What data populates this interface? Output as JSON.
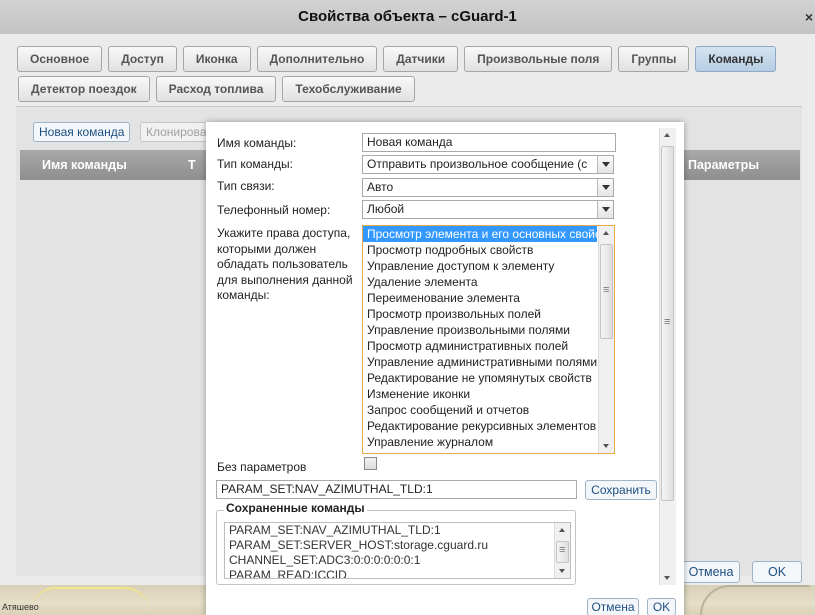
{
  "window": {
    "title": "Свойства объекта – cGuard-1",
    "close": "×"
  },
  "tabs_row1": [
    {
      "label": "Основное",
      "active": false
    },
    {
      "label": "Доступ",
      "active": false
    },
    {
      "label": "Иконка",
      "active": false
    },
    {
      "label": "Дополнительно",
      "active": false
    },
    {
      "label": "Датчики",
      "active": false
    },
    {
      "label": "Произвольные поля",
      "active": false
    },
    {
      "label": "Группы",
      "active": false
    },
    {
      "label": "Команды",
      "active": true
    }
  ],
  "tabs_row2": [
    {
      "label": "Детектор поездок"
    },
    {
      "label": "Расход топлива"
    },
    {
      "label": "Техобслуживание"
    }
  ],
  "commands_panel": {
    "new_command": "Новая команда",
    "clone": "Клонирова",
    "col_name": "Имя команды",
    "col_type": "Т",
    "col_params": "Параметры",
    "cancel": "Отмена",
    "ok": "OK"
  },
  "dialog": {
    "name_label": "Имя команды:",
    "name_value": "Новая команда",
    "type_label": "Тип команды:",
    "type_value": "Отправить произвольное сообщение (с",
    "link_label": "Тип связи:",
    "link_value": "Авто",
    "phone_label": "Телефонный номер:",
    "phone_value": "Любой",
    "rights_label_lines": [
      "Укажите права доступа,",
      "которыми должен",
      "обладать пользователь",
      "для выполнения данной",
      "команды:"
    ],
    "rights_options": [
      "Просмотр элемента и его основных свойств",
      "Просмотр подробных свойств",
      "Управление доступом к элементу",
      "Удаление элемента",
      "Переименование элемента",
      "Просмотр произвольных полей",
      "Управление произвольными полями",
      "Просмотр административных полей",
      "Управление административными полями",
      "Редактирование не упомянутых свойств",
      "Изменение иконки",
      "Запрос сообщений и отчетов",
      "Редактирование рекурсивных элементов",
      "Управление журналом"
    ],
    "rights_selected_index": 0,
    "no_params_label": "Без параметров",
    "no_params_checked": false,
    "param_value": "PARAM_SET:NAV_AZIMUTHAL_TLD:1",
    "save": "Сохранить",
    "saved_legend": "Сохраненные команды",
    "saved_commands": [
      "PARAM_SET:NAV_AZIMUTHAL_TLD:1",
      "PARAM_SET:SERVER_HOST:storage.cguard.ru",
      "CHANNEL_SET:ADC3:0:0:0:0:0:0:1",
      "PARAM_READ:ICCID"
    ],
    "cancel": "Отмена",
    "ok": "OK"
  },
  "map": {
    "place_label": "Атяшево"
  },
  "colors": {
    "selection": "#3399ff",
    "focus_border": "#e7a84a",
    "active_tab": "#b7cde2",
    "link_text": "#1d4f82"
  }
}
